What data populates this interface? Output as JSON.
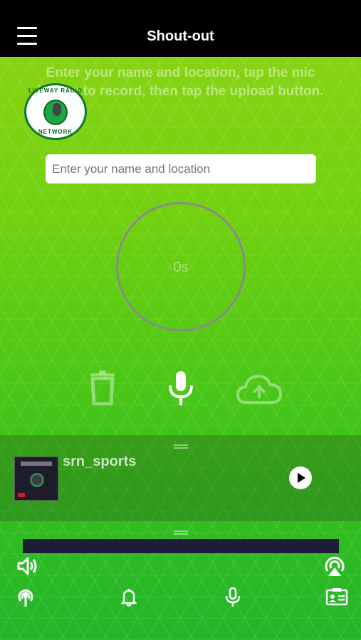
{
  "header": {
    "title": "Shout-out",
    "menu_icon": "hamburger-menu-icon"
  },
  "instructions": "Enter your name and location, tap the mic button to record, then tap the upload button.",
  "logo": {
    "text_top": "LIVEWAY RADIO",
    "text_bottom": "NETWORK"
  },
  "form": {
    "name_placeholder": "Enter your name and location",
    "name_value": ""
  },
  "recorder": {
    "timer": "0s",
    "actions": [
      "trash-icon",
      "microphone-icon",
      "cloud-upload-icon"
    ]
  },
  "player": {
    "track": "srn_sports",
    "play_icon": "play-icon"
  },
  "bottom_bar": {
    "icons": [
      "volume-icon",
      "airplay-icon",
      "broadcast-icon",
      "bell-icon",
      "microphone-icon",
      "contact-card-icon"
    ]
  },
  "colors": {
    "header_bg": "#000000",
    "accent_green": "#6fd10f",
    "progress_bar": "#1c1e38"
  }
}
